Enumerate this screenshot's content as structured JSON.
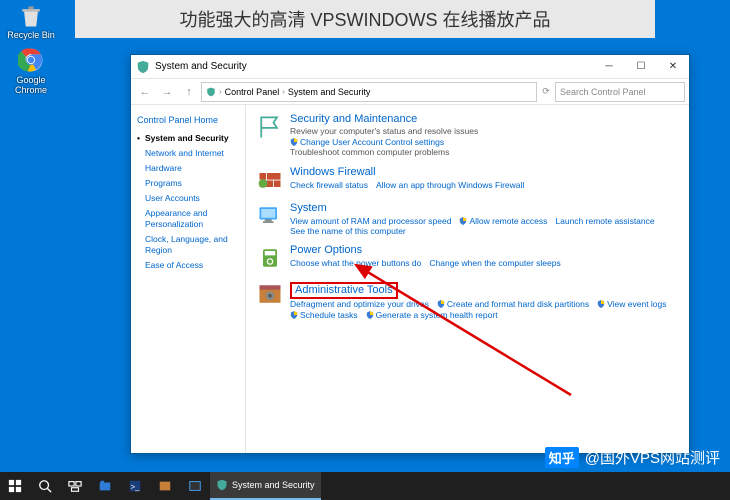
{
  "banner": "功能强大的高清 VPSWINDOWS 在线播放产品",
  "desktop": {
    "recycle": "Recycle Bin",
    "chrome": "Google Chrome"
  },
  "window": {
    "title": "System and Security",
    "breadcrumb": [
      "Control Panel",
      "System and Security"
    ],
    "search_placeholder": "Search Control Panel"
  },
  "sidebar": {
    "header": "Control Panel Home",
    "items": [
      {
        "label": "System and Security",
        "active": true
      },
      {
        "label": "Network and Internet"
      },
      {
        "label": "Hardware"
      },
      {
        "label": "Programs"
      },
      {
        "label": "User Accounts"
      },
      {
        "label": "Appearance and Personalization"
      },
      {
        "label": "Clock, Language, and Region"
      },
      {
        "label": "Ease of Access"
      }
    ]
  },
  "categories": [
    {
      "title": "Security and Maintenance",
      "sub": "Review your computer's status and resolve issues",
      "links": [
        {
          "label": "Change User Account Control settings",
          "shield": true
        }
      ],
      "sub2": "Troubleshoot common computer problems",
      "icon": "flag"
    },
    {
      "title": "Windows Firewall",
      "links": [
        {
          "label": "Check firewall status"
        },
        {
          "label": "Allow an app through Windows Firewall"
        }
      ],
      "icon": "wall"
    },
    {
      "title": "System",
      "links": [
        {
          "label": "View amount of RAM and processor speed"
        },
        {
          "label": "Allow remote access",
          "shield": true
        },
        {
          "label": "Launch remote assistance"
        },
        {
          "label": "See the name of this computer"
        }
      ],
      "icon": "system"
    },
    {
      "title": "Power Options",
      "links": [
        {
          "label": "Choose what the power buttons do"
        },
        {
          "label": "Change when the computer sleeps"
        }
      ],
      "icon": "power"
    },
    {
      "title": "Administrative Tools",
      "highlight": true,
      "links": [
        {
          "label": "Defragment and optimize your drives"
        },
        {
          "label": "Create and format hard disk partitions",
          "shield": true
        },
        {
          "label": "View event logs",
          "shield": true
        },
        {
          "label": "Schedule tasks",
          "shield": true
        },
        {
          "label": "Generate a system health report",
          "shield": true
        }
      ],
      "icon": "tools"
    }
  ],
  "watermark": {
    "logo": "知乎",
    "text": "@国外VPS网站测评"
  },
  "taskbar": {
    "active_task": "System and Security"
  }
}
